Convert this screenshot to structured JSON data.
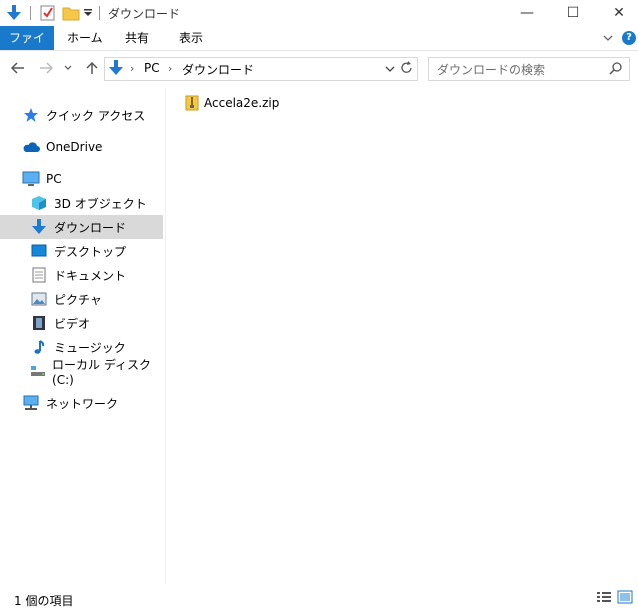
{
  "window": {
    "title": "ダウンロード",
    "controls": {
      "minimize": "—",
      "maximize": "☐",
      "close": "✕"
    }
  },
  "ribbon": {
    "tabs": [
      {
        "label": "ファイル",
        "active": true
      },
      {
        "label": "ホーム"
      },
      {
        "label": "共有"
      },
      {
        "label": "表示"
      }
    ],
    "help_icon": "?"
  },
  "address": {
    "path": [
      "PC",
      "ダウンロード"
    ],
    "search_placeholder": "ダウンロードの検索"
  },
  "nav_pane": {
    "quick_access": "クイック アクセス",
    "onedrive": "OneDrive",
    "pc": "PC",
    "pc_items": [
      {
        "label": "3D オブジェクト",
        "icon": "cube-icon"
      },
      {
        "label": "ダウンロード",
        "icon": "download-arrow-icon",
        "selected": true
      },
      {
        "label": "デスクトップ",
        "icon": "desktop-icon"
      },
      {
        "label": "ドキュメント",
        "icon": "document-icon"
      },
      {
        "label": "ピクチャ",
        "icon": "picture-icon"
      },
      {
        "label": "ビデオ",
        "icon": "video-icon"
      },
      {
        "label": "ミュージック",
        "icon": "music-icon"
      },
      {
        "label": "ローカル ディスク (C:)",
        "icon": "drive-icon"
      }
    ],
    "network": "ネットワーク"
  },
  "files": [
    {
      "name": "Accela2e.zip",
      "icon": "zip-folder-icon"
    }
  ],
  "status": {
    "count_text": "1 個の項目"
  },
  "colors": {
    "accent": "#1979ca",
    "selection": "#d9d9d9"
  }
}
